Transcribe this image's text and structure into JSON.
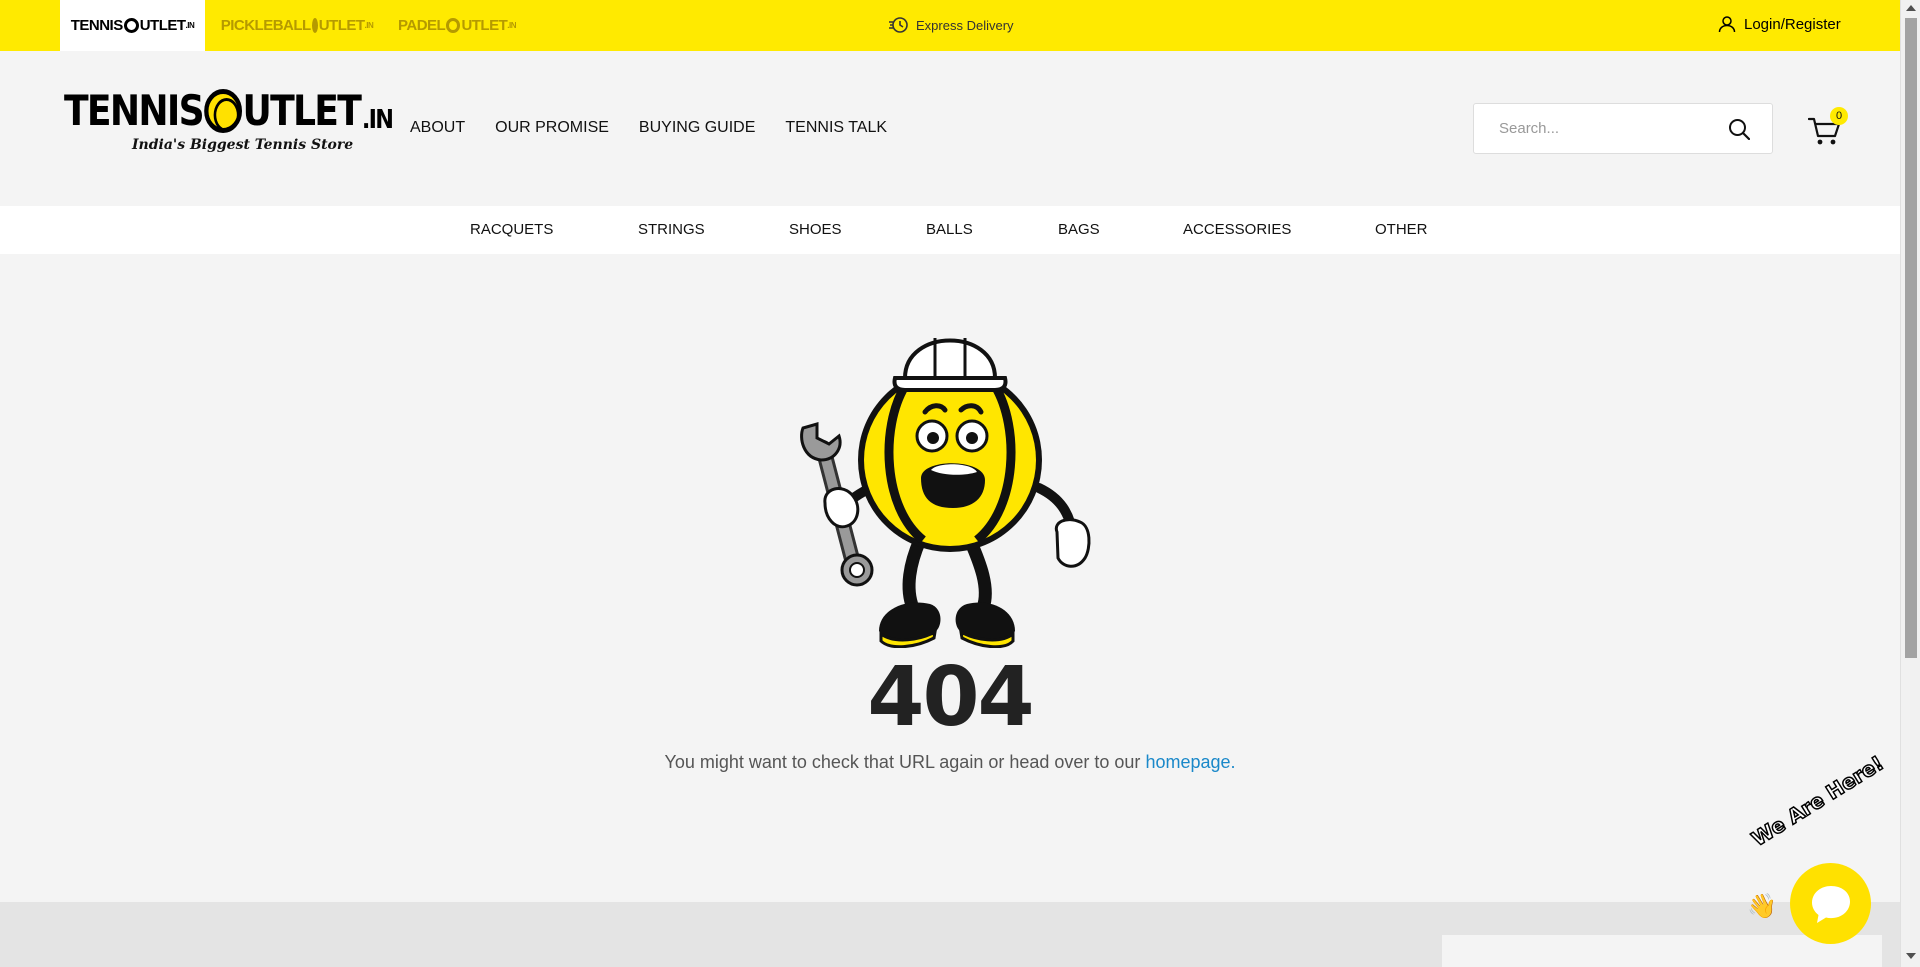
{
  "topbar": {
    "sites": [
      {
        "name_a": "TENNIS",
        "name_b": "UTLET",
        "tld": ".IN"
      },
      {
        "name_a": "PICKLEBALL",
        "name_b": "UTLET",
        "tld": ".IN"
      },
      {
        "name_a": "PADEL",
        "name_b": "UTLET",
        "tld": ".IN"
      }
    ],
    "express": "Express Delivery",
    "login": "Login/Register",
    "colors": {
      "bar": "#ffea00"
    }
  },
  "header": {
    "logo": {
      "word_a": "TENNIS",
      "word_b": "UTLET",
      "tld": ".IN",
      "tagline": "India's Biggest Tennis Store"
    },
    "nav": [
      "ABOUT",
      "OUR PROMISE",
      "BUYING GUIDE",
      "TENNIS TALK"
    ],
    "search": {
      "placeholder": "Search..."
    },
    "cart": {
      "count": "0"
    }
  },
  "categories": [
    "RACQUETS",
    "STRINGS",
    "SHOES",
    "BALLS",
    "BAGS",
    "ACCESSORIES",
    "OTHER"
  ],
  "error": {
    "code": "404",
    "message": "You might want to check that URL again or head over to our ",
    "link": "homepage."
  },
  "chat": {
    "label": "We Are Here!"
  }
}
